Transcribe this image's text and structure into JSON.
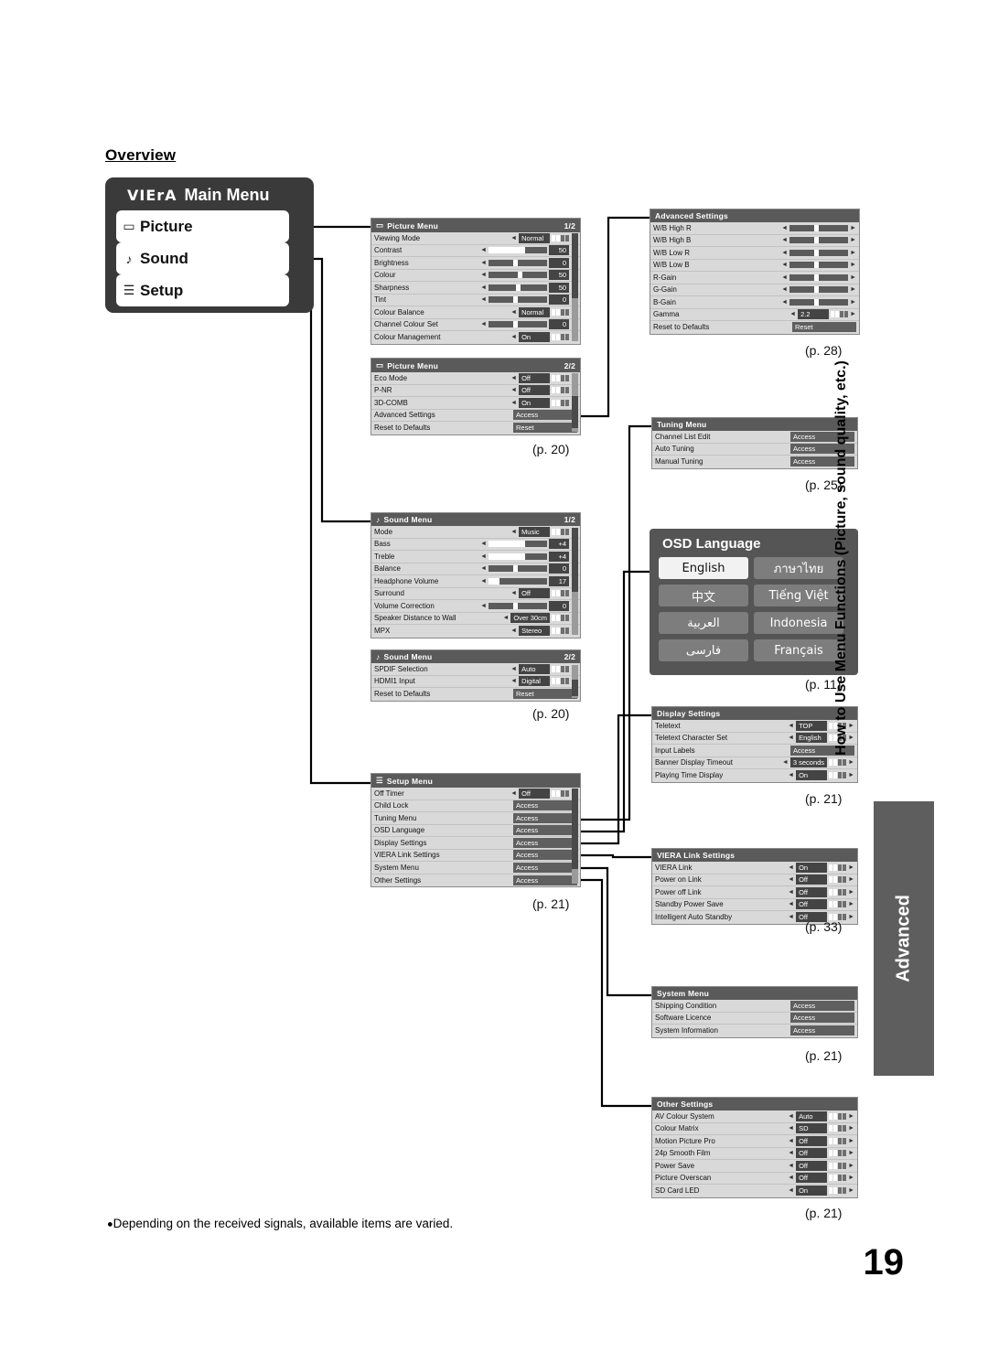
{
  "overview_heading": "Overview",
  "main_menu": {
    "brand": "VIErA",
    "title": "Main Menu",
    "items": [
      {
        "icon": "picture-icon",
        "label": "Picture"
      },
      {
        "icon": "sound-note-icon",
        "label": "Sound"
      },
      {
        "icon": "setup-list-icon",
        "label": "Setup"
      }
    ]
  },
  "panels": {
    "picture1": {
      "title": "Picture Menu",
      "page": "1/2",
      "rows": [
        {
          "name": "Viewing Mode",
          "value": "Normal",
          "type": "select"
        },
        {
          "name": "Contrast",
          "value": "50",
          "type": "bar",
          "fill": 62
        },
        {
          "name": "Brightness",
          "value": "0",
          "type": "bar",
          "fill": 50
        },
        {
          "name": "Colour",
          "value": "50",
          "type": "bar",
          "fill": 58
        },
        {
          "name": "Sharpness",
          "value": "50",
          "type": "bar",
          "fill": 55
        },
        {
          "name": "Tint",
          "value": "0",
          "type": "bar",
          "fill": 50
        },
        {
          "name": "Colour Balance",
          "value": "Normal",
          "type": "select"
        },
        {
          "name": "Channel Colour Set",
          "value": "0",
          "type": "bar",
          "fill": 50
        },
        {
          "name": "Colour Management",
          "value": "On",
          "type": "select"
        }
      ]
    },
    "picture2": {
      "title": "Picture Menu",
      "page": "2/2",
      "rows": [
        {
          "name": "Eco Mode",
          "value": "Off",
          "type": "select"
        },
        {
          "name": "P-NR",
          "value": "Off",
          "type": "select"
        },
        {
          "name": "3D-COMB",
          "value": "On",
          "type": "select"
        },
        {
          "name": "Advanced Settings",
          "value": "Access",
          "type": "access"
        },
        {
          "name": "Reset to Defaults",
          "value": "Reset",
          "type": "reset"
        }
      ]
    },
    "advanced_settings": {
      "title": "Advanced Settings",
      "rows": [
        {
          "name": "W/B High R",
          "value": "",
          "type": "bar",
          "fill": 50
        },
        {
          "name": "W/B High B",
          "value": "",
          "type": "bar",
          "fill": 50
        },
        {
          "name": "W/B Low R",
          "value": "",
          "type": "bar",
          "fill": 50
        },
        {
          "name": "W/B Low B",
          "value": "",
          "type": "bar",
          "fill": 50
        },
        {
          "name": "R-Gain",
          "value": "",
          "type": "bar",
          "fill": 50
        },
        {
          "name": "G-Gain",
          "value": "",
          "type": "bar",
          "fill": 50
        },
        {
          "name": "B-Gain",
          "value": "",
          "type": "bar",
          "fill": 50
        },
        {
          "name": "Gamma",
          "value": "2.2",
          "type": "select"
        },
        {
          "name": "Reset to Defaults",
          "value": "Reset",
          "type": "reset"
        }
      ]
    },
    "tuning": {
      "title": "Tuning Menu",
      "rows": [
        {
          "name": "Channel List Edit",
          "value": "Access",
          "type": "access"
        },
        {
          "name": "Auto Tuning",
          "value": "Access",
          "type": "access"
        },
        {
          "name": "Manual Tuning",
          "value": "Access",
          "type": "access"
        }
      ]
    },
    "sound1": {
      "title": "Sound Menu",
      "page": "1/2",
      "rows": [
        {
          "name": "Mode",
          "value": "Music",
          "type": "select"
        },
        {
          "name": "Bass",
          "value": "+4",
          "type": "bar",
          "fill": 62
        },
        {
          "name": "Treble",
          "value": "+4",
          "type": "bar",
          "fill": 62
        },
        {
          "name": "Balance",
          "value": "0",
          "type": "bar",
          "fill": 50
        },
        {
          "name": "Headphone Volume",
          "value": "17",
          "type": "bar",
          "fill": 18
        },
        {
          "name": "Surround",
          "value": "Off",
          "type": "select"
        },
        {
          "name": "Volume Correction",
          "value": "0",
          "type": "bar",
          "fill": 50
        },
        {
          "name": "Speaker Distance to Wall",
          "value": "Over 30cm",
          "type": "select"
        },
        {
          "name": "MPX",
          "value": "Stereo",
          "type": "select"
        }
      ]
    },
    "sound2": {
      "title": "Sound Menu",
      "page": "2/2",
      "rows": [
        {
          "name": "SPDIF Selection",
          "value": "Auto",
          "type": "select"
        },
        {
          "name": "HDMI1 Input",
          "value": "Digital",
          "type": "select"
        },
        {
          "name": "Reset to Defaults",
          "value": "Reset",
          "type": "reset"
        }
      ]
    },
    "setup": {
      "title": "Setup Menu",
      "rows": [
        {
          "name": "Off Timer",
          "value": "Off",
          "type": "select"
        },
        {
          "name": "Child Lock",
          "value": "Access",
          "type": "access"
        },
        {
          "name": "Tuning Menu",
          "value": "Access",
          "type": "access"
        },
        {
          "name": "OSD Language",
          "value": "Access",
          "type": "access"
        },
        {
          "name": "Display Settings",
          "value": "Access",
          "type": "access"
        },
        {
          "name": "VIERA Link Settings",
          "value": "Access",
          "type": "access"
        },
        {
          "name": "System Menu",
          "value": "Access",
          "type": "access"
        },
        {
          "name": "Other Settings",
          "value": "Access",
          "type": "access"
        }
      ]
    },
    "display_settings": {
      "title": "Display Settings",
      "rows": [
        {
          "name": "Teletext",
          "value": "TOP",
          "type": "select"
        },
        {
          "name": "Teletext Character Set",
          "value": "English",
          "type": "select"
        },
        {
          "name": "Input Labels",
          "value": "Access",
          "type": "access"
        },
        {
          "name": "Banner Display Timeout",
          "value": "3 seconds",
          "type": "select"
        },
        {
          "name": "Playing Time Display",
          "value": "On",
          "type": "select"
        }
      ]
    },
    "viera_link": {
      "title": "VIERA Link Settings",
      "rows": [
        {
          "name": "VIERA Link",
          "value": "On",
          "type": "select"
        },
        {
          "name": "Power on Link",
          "value": "Off",
          "type": "select"
        },
        {
          "name": "Power off Link",
          "value": "Off",
          "type": "select"
        },
        {
          "name": "Standby Power Save",
          "value": "Off",
          "type": "select"
        },
        {
          "name": "Intelligent Auto Standby",
          "value": "Off",
          "type": "select"
        }
      ]
    },
    "system": {
      "title": "System Menu",
      "rows": [
        {
          "name": "Shipping Condition",
          "value": "Access",
          "type": "access"
        },
        {
          "name": "Software Licence",
          "value": "Access",
          "type": "access"
        },
        {
          "name": "System Information",
          "value": "Access",
          "type": "access"
        }
      ]
    },
    "other_settings": {
      "title": "Other Settings",
      "rows": [
        {
          "name": "AV Colour System",
          "value": "Auto",
          "type": "select"
        },
        {
          "name": "Colour Matrix",
          "value": "SD",
          "type": "select"
        },
        {
          "name": "Motion Picture Pro",
          "value": "Off",
          "type": "select"
        },
        {
          "name": "24p Smooth Film",
          "value": "Off",
          "type": "select"
        },
        {
          "name": "Power Save",
          "value": "Off",
          "type": "select"
        },
        {
          "name": "Picture Overscan",
          "value": "Off",
          "type": "select"
        },
        {
          "name": "SD Card LED",
          "value": "On",
          "type": "select"
        }
      ]
    }
  },
  "osd_language": {
    "title": "OSD Language",
    "buttons": [
      {
        "label": "English",
        "style": "white"
      },
      {
        "label": "ภาษาไทย",
        "style": "grey"
      },
      {
        "label": "中文",
        "style": "grey"
      },
      {
        "label": "Tiếng Việt",
        "style": "grey"
      },
      {
        "label": "العربية",
        "style": "grey"
      },
      {
        "label": "Indonesia",
        "style": "grey"
      },
      {
        "label": "فارسى",
        "style": "grey"
      },
      {
        "label": "Français",
        "style": "grey"
      }
    ]
  },
  "page_refs": {
    "picture": "(p. 20)",
    "advanced": "(p. 28)",
    "tuning": "(p. 25)",
    "sound": "(p. 20)",
    "osd_language": "(p. 11)",
    "setup": "(p. 21)",
    "display": "(p. 21)",
    "viera_link": "(p. 33)",
    "system": "(p. 21)",
    "other": "(p. 21)"
  },
  "vertical_title": "How to Use Menu Functions (Picture, sound quality, etc.)",
  "side_tab": "Advanced",
  "footnote": "Depending on the received signals, available items are varied.",
  "page_number": "19"
}
